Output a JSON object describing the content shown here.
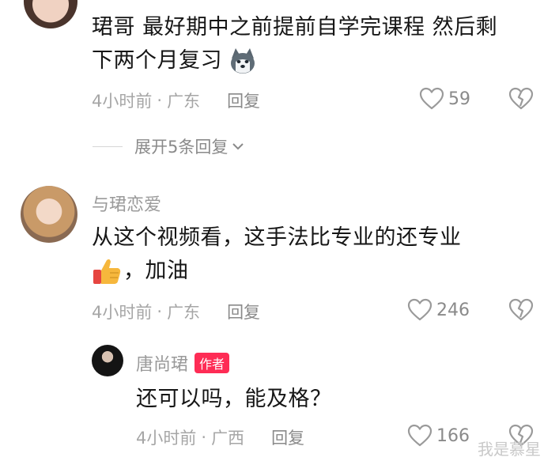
{
  "comments": [
    {
      "text_line1": "珺哥 最好期中之前提前自学完课程 然后剩",
      "text_line2": "下两个月复习",
      "emoji": "husky-emoji",
      "time": "4小时前",
      "dot": "·",
      "location": "广东",
      "reply_label": "回复",
      "likes": "59"
    },
    {
      "username": "与珺恋爱",
      "text_line1": "从这个视频看，这手法比专业的还专业",
      "text_line2": "，加油",
      "emoji": "thumbs-up-emoji",
      "time": "4小时前",
      "dot": "·",
      "location": "广东",
      "reply_label": "回复",
      "likes": "246"
    }
  ],
  "expand_replies": {
    "label": "展开5条回复"
  },
  "reply": {
    "username": "唐尚珺",
    "author_tag": "作者",
    "text": "还可以吗，能及格？",
    "time": "4小时前",
    "dot": "·",
    "location": "广西",
    "reply_label": "回复",
    "likes": "166"
  },
  "watermark": "我是慕星",
  "colors": {
    "author_tag": "#fe2c55",
    "meta": "#a6a6a6",
    "text": "#161616"
  }
}
